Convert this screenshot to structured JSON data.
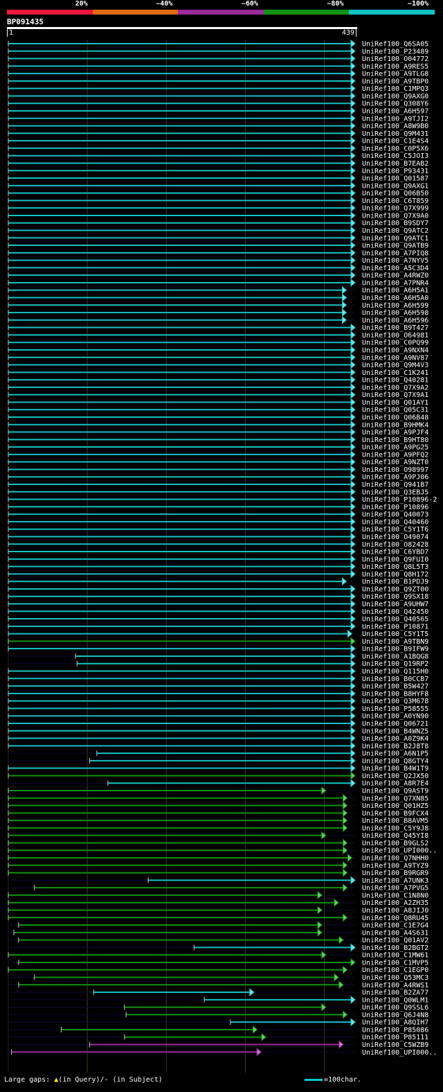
{
  "identity_scale": {
    "labels": [
      "20%",
      "~40%",
      "~60%",
      "~80%",
      "~100%"
    ],
    "colors": [
      "#e8183c",
      "#e06b14",
      "#9b2a9b",
      "#119411",
      "#13c4c4"
    ]
  },
  "query": {
    "id": "BP091435",
    "start_label": "1",
    "end_label": "439"
  },
  "footer": {
    "gaps_prefix": "Large gaps:",
    "gaps_query": "(in Query)/",
    "gaps_subject": "- (in Subject)",
    "scale_label": "=100char."
  },
  "chart_data": {
    "type": "alignment-overview",
    "query_length": 439,
    "hits": [
      {
        "label": "UniRef100_Q6SA05",
        "start": 1,
        "end": 439,
        "color": "cyan"
      },
      {
        "label": "UniRef100_P23489",
        "start": 1,
        "end": 439,
        "color": "cyan"
      },
      {
        "label": "UniRef100_O04772",
        "start": 1,
        "end": 439,
        "color": "cyan"
      },
      {
        "label": "UniRef100_A9RES5",
        "start": 1,
        "end": 439,
        "color": "cyan"
      },
      {
        "label": "UniRef100_A9TLG8",
        "start": 1,
        "end": 439,
        "color": "cyan"
      },
      {
        "label": "UniRef100_A9TBP0",
        "start": 1,
        "end": 439,
        "color": "cyan"
      },
      {
        "label": "UniRef100_C1MPQ3",
        "start": 1,
        "end": 439,
        "color": "cyan"
      },
      {
        "label": "UniRef100_Q9AXG0",
        "start": 1,
        "end": 439,
        "color": "cyan"
      },
      {
        "label": "UniRef100_Q308Y6",
        "start": 1,
        "end": 439,
        "color": "cyan"
      },
      {
        "label": "UniRef100_A6H597",
        "start": 1,
        "end": 439,
        "color": "cyan"
      },
      {
        "label": "UniRef100_A9TJI2",
        "start": 1,
        "end": 439,
        "color": "cyan"
      },
      {
        "label": "UniRef100_A8W9B0",
        "start": 1,
        "end": 439,
        "color": "cyan"
      },
      {
        "label": "UniRef100_Q9M431",
        "start": 1,
        "end": 439,
        "color": "cyan"
      },
      {
        "label": "UniRef100_C1E4S4",
        "start": 1,
        "end": 439,
        "color": "cyan"
      },
      {
        "label": "UniRef100_C0P5X6",
        "start": 1,
        "end": 439,
        "color": "cyan"
      },
      {
        "label": "UniRef100_C5JOI3",
        "start": 1,
        "end": 439,
        "color": "cyan"
      },
      {
        "label": "UniRef100_B7EAB2",
        "start": 1,
        "end": 439,
        "color": "cyan"
      },
      {
        "label": "UniRef100_P93431",
        "start": 1,
        "end": 439,
        "color": "cyan"
      },
      {
        "label": "UniRef100_Q01587",
        "start": 1,
        "end": 439,
        "color": "cyan"
      },
      {
        "label": "UniRef100_Q9AXG1",
        "start": 1,
        "end": 439,
        "color": "cyan"
      },
      {
        "label": "UniRef100_Q06B50",
        "start": 1,
        "end": 439,
        "color": "cyan"
      },
      {
        "label": "UniRef100_C6T859",
        "start": 1,
        "end": 439,
        "color": "cyan"
      },
      {
        "label": "UniRef100_Q7X999",
        "start": 1,
        "end": 439,
        "color": "cyan"
      },
      {
        "label": "UniRef100_Q7X9A0",
        "start": 1,
        "end": 439,
        "color": "cyan"
      },
      {
        "label": "UniRef100_B9SDY7",
        "start": 1,
        "end": 439,
        "color": "cyan"
      },
      {
        "label": "UniRef100_Q9ATC2",
        "start": 1,
        "end": 439,
        "color": "cyan"
      },
      {
        "label": "UniRef100_Q9ATC1",
        "start": 1,
        "end": 439,
        "color": "cyan"
      },
      {
        "label": "UniRef100_Q9ATB9",
        "start": 1,
        "end": 439,
        "color": "cyan"
      },
      {
        "label": "UniRef100_A7PIQ8",
        "start": 1,
        "end": 439,
        "color": "cyan"
      },
      {
        "label": "UniRef100_A7NYV5",
        "start": 1,
        "end": 439,
        "color": "cyan"
      },
      {
        "label": "UniRef100_A5C3D4",
        "start": 1,
        "end": 439,
        "color": "cyan"
      },
      {
        "label": "UniRef100_A4RWZ0",
        "start": 1,
        "end": 439,
        "color": "cyan"
      },
      {
        "label": "UniRef100_A7PNR4",
        "start": 1,
        "end": 439,
        "color": "cyan"
      },
      {
        "label": "UniRef100_A6H5A1",
        "start": 1,
        "end": 428,
        "color": "cyan"
      },
      {
        "label": "UniRef100_A6H5A0",
        "start": 1,
        "end": 428,
        "color": "cyan"
      },
      {
        "label": "UniRef100_A6H599",
        "start": 1,
        "end": 428,
        "color": "cyan"
      },
      {
        "label": "UniRef100_A6H598",
        "start": 1,
        "end": 428,
        "color": "cyan"
      },
      {
        "label": "UniRef100_A6H596",
        "start": 1,
        "end": 428,
        "color": "cyan"
      },
      {
        "label": "UniRef100_B9T427",
        "start": 1,
        "end": 439,
        "color": "cyan"
      },
      {
        "label": "UniRef100_O64981",
        "start": 1,
        "end": 439,
        "color": "cyan"
      },
      {
        "label": "UniRef100_C0PQ99",
        "start": 1,
        "end": 439,
        "color": "cyan"
      },
      {
        "label": "UniRef100_A9NXN4",
        "start": 1,
        "end": 439,
        "color": "cyan"
      },
      {
        "label": "UniRef100_A9NV87",
        "start": 1,
        "end": 439,
        "color": "cyan"
      },
      {
        "label": "UniRef100_Q9M4V3",
        "start": 1,
        "end": 439,
        "color": "cyan"
      },
      {
        "label": "UniRef100_C1K241",
        "start": 1,
        "end": 439,
        "color": "cyan"
      },
      {
        "label": "UniRef100_Q40281",
        "start": 1,
        "end": 439,
        "color": "cyan"
      },
      {
        "label": "UniRef100_Q7X9A2",
        "start": 1,
        "end": 439,
        "color": "cyan"
      },
      {
        "label": "UniRef100_Q7X9A1",
        "start": 1,
        "end": 439,
        "color": "cyan"
      },
      {
        "label": "UniRef100_Q01AY1",
        "start": 1,
        "end": 439,
        "color": "cyan"
      },
      {
        "label": "UniRef100_Q05C31",
        "start": 1,
        "end": 439,
        "color": "cyan"
      },
      {
        "label": "UniRef100_Q06B48",
        "start": 1,
        "end": 439,
        "color": "cyan"
      },
      {
        "label": "UniRef100_B9HMK4",
        "start": 1,
        "end": 439,
        "color": "cyan"
      },
      {
        "label": "UniRef100_A9PJF4",
        "start": 1,
        "end": 439,
        "color": "cyan"
      },
      {
        "label": "UniRef100_B9HT80",
        "start": 1,
        "end": 439,
        "color": "cyan"
      },
      {
        "label": "UniRef100_A9PG25",
        "start": 1,
        "end": 439,
        "color": "cyan"
      },
      {
        "label": "UniRef100_A9PFQ2",
        "start": 1,
        "end": 439,
        "color": "cyan"
      },
      {
        "label": "UniRef100_A9NZT0",
        "start": 1,
        "end": 439,
        "color": "cyan"
      },
      {
        "label": "UniRef100_O98997",
        "start": 1,
        "end": 439,
        "color": "cyan"
      },
      {
        "label": "UniRef100_A9PJ06",
        "start": 1,
        "end": 439,
        "color": "cyan"
      },
      {
        "label": "UniRef100_Q941B7",
        "start": 1,
        "end": 439,
        "color": "cyan"
      },
      {
        "label": "UniRef100_Q3EBJ5",
        "start": 1,
        "end": 439,
        "color": "cyan"
      },
      {
        "label": "UniRef100_P10896-2",
        "start": 1,
        "end": 439,
        "color": "cyan"
      },
      {
        "label": "UniRef100_P10896",
        "start": 1,
        "end": 439,
        "color": "cyan"
      },
      {
        "label": "UniRef100_Q40073",
        "start": 1,
        "end": 439,
        "color": "cyan"
      },
      {
        "label": "UniRef100_Q40460",
        "start": 1,
        "end": 439,
        "color": "cyan"
      },
      {
        "label": "UniRef100_C5Y1T6",
        "start": 1,
        "end": 439,
        "color": "cyan"
      },
      {
        "label": "UniRef100_O49074",
        "start": 1,
        "end": 439,
        "color": "cyan"
      },
      {
        "label": "UniRef100_O82428",
        "start": 1,
        "end": 439,
        "color": "cyan"
      },
      {
        "label": "UniRef100_C6YBD7",
        "start": 1,
        "end": 439,
        "color": "cyan"
      },
      {
        "label": "UniRef100_Q9FUI0",
        "start": 1,
        "end": 439,
        "color": "cyan"
      },
      {
        "label": "UniRef100_Q8L5T3",
        "start": 1,
        "end": 439,
        "color": "cyan"
      },
      {
        "label": "UniRef100_Q8H172",
        "start": 1,
        "end": 439,
        "color": "cyan"
      },
      {
        "label": "UniRef100_B1PDJ9",
        "start": 1,
        "end": 428,
        "color": "cyan"
      },
      {
        "label": "UniRef100_Q9ZT00",
        "start": 1,
        "end": 439,
        "color": "cyan"
      },
      {
        "label": "UniRef100_Q9SX18",
        "start": 1,
        "end": 439,
        "color": "cyan"
      },
      {
        "label": "UniRef100_A9UHW7",
        "start": 1,
        "end": 439,
        "color": "cyan"
      },
      {
        "label": "UniRef100_Q42450",
        "start": 1,
        "end": 439,
        "color": "cyan"
      },
      {
        "label": "UniRef100_Q40565",
        "start": 1,
        "end": 439,
        "color": "cyan"
      },
      {
        "label": "UniRef100_P10871",
        "start": 1,
        "end": 439,
        "color": "cyan"
      },
      {
        "label": "UniRef100_C5Y1T5",
        "start": 1,
        "end": 435,
        "color": "cyan"
      },
      {
        "label": "UniRef100_A9TBN9",
        "start": 1,
        "end": 439,
        "color": "green"
      },
      {
        "label": "UniRef100_B9IFW9",
        "start": 1,
        "end": 439,
        "color": "cyan"
      },
      {
        "label": "UniRef100_A1BQG8",
        "start": 86,
        "end": 439,
        "color": "cyan"
      },
      {
        "label": "UniRef100_Q19RP2",
        "start": 88,
        "end": 439,
        "color": "cyan"
      },
      {
        "label": "UniRef100_Q115H0",
        "start": 1,
        "end": 439,
        "color": "cyan"
      },
      {
        "label": "UniRef100_B0CCB7",
        "start": 1,
        "end": 439,
        "color": "cyan"
      },
      {
        "label": "UniRef100_B5W427",
        "start": 1,
        "end": 439,
        "color": "cyan"
      },
      {
        "label": "UniRef100_B8HYF8",
        "start": 1,
        "end": 439,
        "color": "cyan"
      },
      {
        "label": "UniRef100_Q3M678",
        "start": 1,
        "end": 439,
        "color": "cyan"
      },
      {
        "label": "UniRef100_P58555",
        "start": 1,
        "end": 439,
        "color": "cyan"
      },
      {
        "label": "UniRef100_A0YN90",
        "start": 1,
        "end": 439,
        "color": "cyan"
      },
      {
        "label": "UniRef100_Q06721",
        "start": 1,
        "end": 439,
        "color": "cyan"
      },
      {
        "label": "UniRef100_B4WNZ5",
        "start": 1,
        "end": 439,
        "color": "cyan"
      },
      {
        "label": "UniRef100_A0Z9K4",
        "start": 1,
        "end": 439,
        "color": "cyan"
      },
      {
        "label": "UniRef100_B2J8T8",
        "start": 1,
        "end": 439,
        "color": "cyan"
      },
      {
        "label": "UniRef100_A6N1P5",
        "start": 113,
        "end": 439,
        "color": "cyan"
      },
      {
        "label": "UniRef100_Q8GTY4",
        "start": 104,
        "end": 439,
        "color": "cyan"
      },
      {
        "label": "UniRef100_B4W1T9",
        "start": 1,
        "end": 439,
        "color": "cyan"
      },
      {
        "label": "UniRef100_Q2JX50",
        "start": 1,
        "end": 439,
        "color": "green"
      },
      {
        "label": "UniRef100_A8R7E4",
        "start": 127,
        "end": 439,
        "color": "cyan"
      },
      {
        "label": "UniRef100_Q9AST9",
        "start": 1,
        "end": 402,
        "color": "green"
      },
      {
        "label": "UniRef100_Q7XN85",
        "start": 1,
        "end": 429,
        "color": "green"
      },
      {
        "label": "UniRef100_Q01HZ5",
        "start": 1,
        "end": 429,
        "color": "green"
      },
      {
        "label": "UniRef100_B9FCX4",
        "start": 1,
        "end": 429,
        "color": "green"
      },
      {
        "label": "UniRef100_B8AVM5",
        "start": 1,
        "end": 429,
        "color": "green"
      },
      {
        "label": "UniRef100_C5Y9J8",
        "start": 1,
        "end": 429,
        "color": "green"
      },
      {
        "label": "UniRef100_Q45YI8",
        "start": 1,
        "end": 402,
        "color": "green"
      },
      {
        "label": "UniRef100_B9GLS2",
        "start": 1,
        "end": 429,
        "color": "green"
      },
      {
        "label": "UniRef100_UPI000..",
        "start": 1,
        "end": 429,
        "color": "green"
      },
      {
        "label": "UniRef100_Q7NHH0",
        "start": 1,
        "end": 435,
        "color": "green"
      },
      {
        "label": "UniRef100_A9TYZ9",
        "start": 1,
        "end": 429,
        "color": "green"
      },
      {
        "label": "UniRef100_B9RGR9",
        "start": 1,
        "end": 429,
        "color": "green"
      },
      {
        "label": "UniRef100_A7UNK3",
        "start": 178,
        "end": 439,
        "color": "cyan"
      },
      {
        "label": "UniRef100_A7PVG5",
        "start": 34,
        "end": 429,
        "color": "green"
      },
      {
        "label": "UniRef100_C1N8N0",
        "start": 1,
        "end": 397,
        "color": "green"
      },
      {
        "label": "UniRef100_A2ZH35",
        "start": 1,
        "end": 418,
        "color": "green"
      },
      {
        "label": "UniRef100_A8JIJ0",
        "start": 1,
        "end": 397,
        "color": "green"
      },
      {
        "label": "UniRef100_Q8RU45",
        "start": 1,
        "end": 429,
        "color": "green"
      },
      {
        "label": "UniRef100_C1E7G4",
        "start": 14,
        "end": 397,
        "color": "green"
      },
      {
        "label": "UniRef100_A4S631",
        "start": 8,
        "end": 397,
        "color": "green"
      },
      {
        "label": "UniRef100_Q01AV2",
        "start": 14,
        "end": 424,
        "color": "green"
      },
      {
        "label": "UniRef100_B2BGT2",
        "start": 236,
        "end": 439,
        "color": "cyan"
      },
      {
        "label": "UniRef100_C1MW61",
        "start": 1,
        "end": 402,
        "color": "green"
      },
      {
        "label": "UniRef100_C1MVP5",
        "start": 14,
        "end": 439,
        "color": "green"
      },
      {
        "label": "UniRef100_C1EGP0",
        "start": 1,
        "end": 429,
        "color": "green"
      },
      {
        "label": "UniRef100_Q53MC3",
        "start": 34,
        "end": 418,
        "color": "green"
      },
      {
        "label": "UniRef100_A4RWS1",
        "start": 14,
        "end": 424,
        "color": "green"
      },
      {
        "label": "UniRef100_B2ZA77",
        "start": 109,
        "end": 311,
        "color": "cyan"
      },
      {
        "label": "UniRef100_Q0WLM1",
        "start": 249,
        "end": 439,
        "color": "cyan"
      },
      {
        "label": "UniRef100_Q9SSL6",
        "start": 148,
        "end": 402,
        "color": "green"
      },
      {
        "label": "UniRef100_Q6J4N8",
        "start": 150,
        "end": 429,
        "color": "green"
      },
      {
        "label": "UniRef100_A8QIH7",
        "start": 282,
        "end": 439,
        "color": "cyan"
      },
      {
        "label": "UniRef100_P85086",
        "start": 68,
        "end": 315,
        "color": "green"
      },
      {
        "label": "UniRef100_P85111",
        "start": 148,
        "end": 326,
        "color": "green"
      },
      {
        "label": "UniRef100_C5WZB9",
        "start": 104,
        "end": 424,
        "color": "purple"
      },
      {
        "label": "UniRef100_UPI000..",
        "start": 5,
        "end": 320,
        "color": "purple"
      }
    ]
  }
}
